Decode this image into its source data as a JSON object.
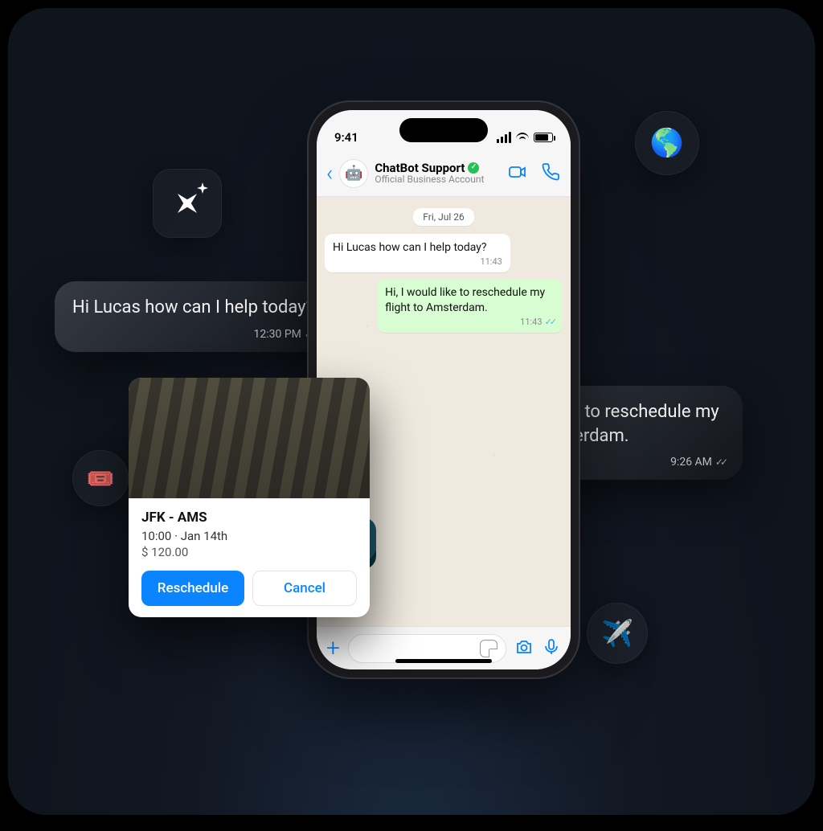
{
  "statusbar": {
    "time": "9:41"
  },
  "chat_header": {
    "title": "ChatBot Support",
    "subtitle": "Official Business Account"
  },
  "date_label": "Fri, Jul 26",
  "chat": {
    "in1": {
      "text": "Hi Lucas how can I help today?",
      "time": "11:43"
    },
    "out1": {
      "text": "Hi, I would like to reschedule my flight to Amsterdam.",
      "time": "11:43"
    }
  },
  "floating": {
    "left": {
      "text": "Hi Lucas how can I help today?",
      "time": "12:30 PM"
    },
    "right": {
      "text": "Hi, I would like to reschedule my flight to Amsterdam.",
      "time": "9:26 AM"
    }
  },
  "flight": {
    "route": "JFK - AMS",
    "when": "10:00 · Jan 14th",
    "price": "$ 120.00",
    "reschedule": "Reschedule",
    "cancel": "Cancel"
  },
  "icons": {
    "globe": "🌎",
    "ticket": "🎟️",
    "plane": "✈️",
    "bot": "🤖"
  }
}
